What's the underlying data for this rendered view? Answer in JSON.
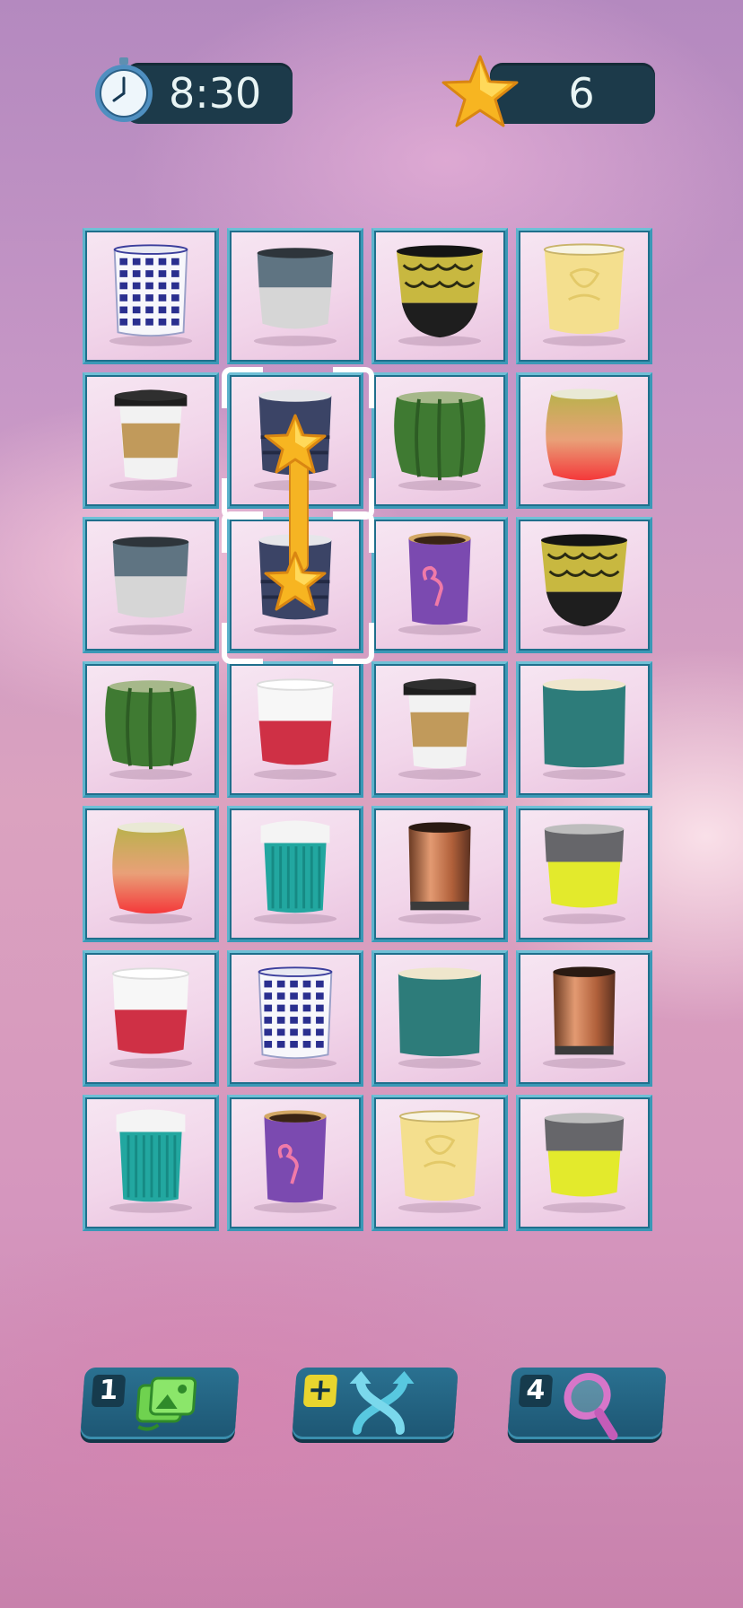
{
  "hud": {
    "timer": "8:30",
    "stars": "6"
  },
  "board": {
    "rows": 7,
    "cols": 4,
    "tiles": [
      "blue-pattern-cup",
      "grey-white-cup",
      "gold-leaf-black-cup",
      "yellow-embossed-cup",
      "takeaway-kraft-cup",
      "navy-ribbed-cup",
      "cactus-cup",
      "peach-gradient-cup",
      "grey-white-cup",
      "navy-ribbed-cup",
      "flamingo-purple-cup",
      "gold-leaf-black-cup",
      "cactus-cup",
      "red-white-silicone-cup",
      "takeaway-kraft-cup",
      "teal-cup",
      "peach-gradient-cup",
      "teal-ribbed-travel-cup",
      "copper-cup",
      "grey-yellow-cup",
      "red-white-silicone-cup",
      "blue-pattern-cup",
      "teal-cup",
      "copper-cup",
      "teal-ribbed-travel-cup",
      "flamingo-purple-cup",
      "yellow-embossed-cup",
      "grey-yellow-cup"
    ],
    "selected": [
      [
        1,
        1
      ],
      [
        2,
        1
      ]
    ]
  },
  "toolbar": {
    "shuffle_count": "1",
    "swap_plus": "+",
    "hint_count": "4"
  },
  "colors": {
    "pill_bg": "#1c3a4a",
    "tile_border": "#3a98b6",
    "tool_bg": "#2a7191",
    "connector": "#f5b423"
  }
}
